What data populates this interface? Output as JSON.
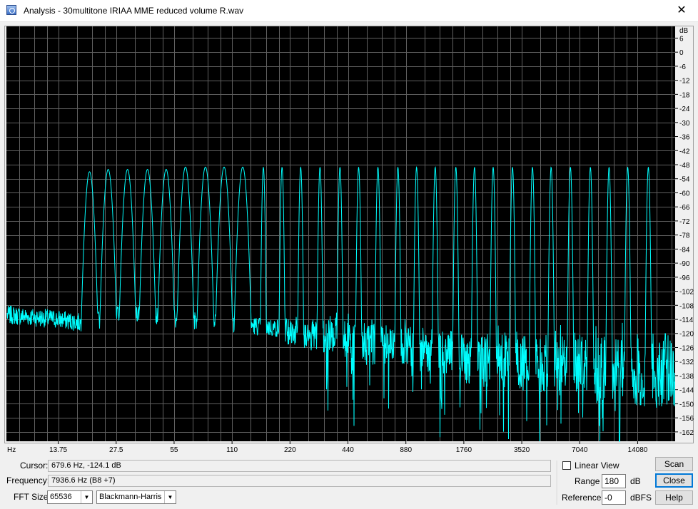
{
  "window": {
    "title": "Analysis - 30multitone IRIAA MME reduced volume R.wav",
    "close_glyph": "✕",
    "icon": "spectrum-app-icon"
  },
  "colors": {
    "plot_bg": "#000000",
    "grid": "#606060",
    "trace": "#00ffff",
    "chrome": "#f0f0f0"
  },
  "chart_data": {
    "type": "line",
    "title": "",
    "x_scale": "log",
    "x_unit_label": "Hz",
    "x_tick_labels": [
      "13.75",
      "27.5",
      "55",
      "110",
      "220",
      "440",
      "880",
      "1760",
      "3520",
      "7040",
      "14080"
    ],
    "x_tick_values": [
      13.75,
      27.5,
      55,
      110,
      220,
      440,
      880,
      1760,
      3520,
      7040,
      14080
    ],
    "xlim": [
      7.4,
      22050
    ],
    "y_unit_label": "dB",
    "y_tick_labels": [
      "6",
      "0",
      "-6",
      "-12",
      "-18",
      "-24",
      "-30",
      "-36",
      "-42",
      "-48",
      "-54",
      "-60",
      "-66",
      "-72",
      "-78",
      "-84",
      "-90",
      "-96",
      "-102",
      "-108",
      "-114",
      "-120",
      "-126",
      "-132",
      "-138",
      "-144",
      "-150",
      "-156",
      "-162"
    ],
    "y_tick_values": [
      6,
      0,
      -6,
      -12,
      -18,
      -24,
      -30,
      -36,
      -42,
      -48,
      -54,
      -60,
      -66,
      -72,
      -78,
      -84,
      -90,
      -96,
      -102,
      -108,
      -114,
      -120,
      -126,
      -132,
      -138,
      -144,
      -150,
      -156,
      -162
    ],
    "ylim": [
      -166,
      11
    ],
    "grid": true,
    "series": [
      {
        "tones_hz": [
          20,
          25,
          31.5,
          40,
          50,
          63,
          80,
          100,
          125,
          160,
          200,
          250,
          315,
          400,
          500,
          630,
          800,
          1000,
          1250,
          1600,
          2000,
          2500,
          3150,
          4000,
          5000,
          6300,
          8000,
          10000,
          12500,
          16000
        ],
        "tone_levels_db": [
          -51,
          -50,
          -50,
          -50,
          -50,
          -49,
          -49,
          -49,
          -49,
          -49,
          -49,
          -49,
          -49,
          -49,
          -49,
          -49,
          -49,
          -49,
          -49,
          -49,
          -49,
          -49,
          -49,
          -49,
          -49,
          -49,
          -49,
          -49,
          -49,
          -49
        ],
        "noise_floor_hz": [
          7.4,
          10,
          14,
          20,
          30,
          50,
          80,
          120,
          200,
          300,
          500,
          800,
          1200,
          2000,
          4000,
          8000,
          22050
        ],
        "noise_floor_db": [
          -112,
          -113,
          -114,
          -116,
          -110,
          -113,
          -115,
          -116,
          -118,
          -121,
          -123,
          -125,
          -128,
          -131,
          -133,
          -135,
          -136
        ]
      }
    ]
  },
  "controls": {
    "cursor_label": "Cursor:",
    "cursor_value": "679.6 Hz, -124.1 dB",
    "frequency_label": "Frequency:",
    "frequency_value": "7936.6 Hz (B8 +7)",
    "fft_size_label": "FFT Size:",
    "fft_size_value": "65536",
    "window_value": "Blackmann-Harris",
    "dropdown_glyph": "▼",
    "linear_view_label": "Linear View",
    "linear_view_checked": false,
    "range_label": "Range",
    "range_value": "180",
    "range_unit": "dB",
    "reference_label": "Reference",
    "reference_value": "-0",
    "reference_unit": "dBFS",
    "scan_label": "Scan",
    "close_label": "Close",
    "help_label": "Help"
  }
}
